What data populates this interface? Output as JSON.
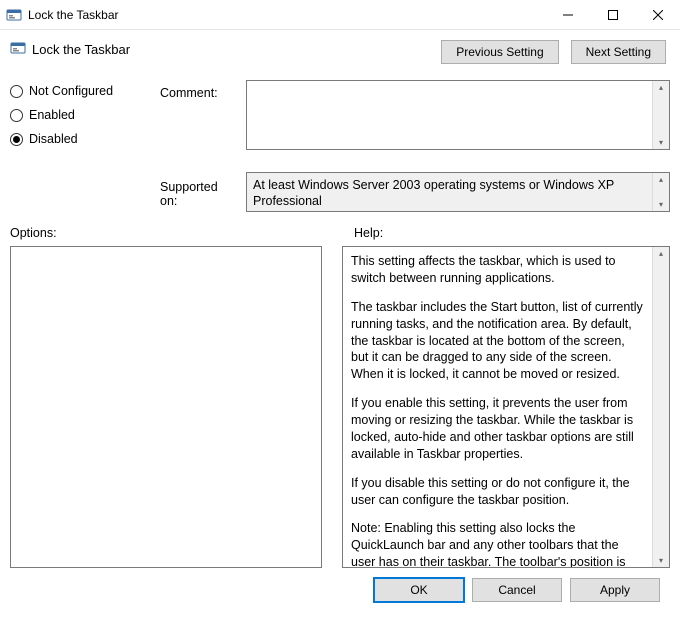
{
  "window": {
    "title": "Lock the Taskbar"
  },
  "header": {
    "policy_name": "Lock the Taskbar",
    "prev_btn": "Previous Setting",
    "next_btn": "Next Setting"
  },
  "radios": {
    "not_configured": "Not Configured",
    "enabled": "Enabled",
    "disabled": "Disabled",
    "selected": "disabled"
  },
  "fields": {
    "comment_label": "Comment:",
    "comment_value": "",
    "supported_label": "Supported on:",
    "supported_value": "At least Windows Server 2003 operating systems or Windows XP Professional"
  },
  "panels": {
    "options_label": "Options:",
    "help_label": "Help:",
    "help_paragraphs": [
      "This setting affects the taskbar, which is used to switch between running applications.",
      "The taskbar includes the Start button, list of currently running tasks, and the notification area. By default, the taskbar is located at the bottom of the screen, but it can be dragged to any side of the screen. When it is locked, it cannot be moved or resized.",
      "If you enable this setting, it prevents the user from moving or resizing the taskbar. While the taskbar is locked, auto-hide and other taskbar options are still available in Taskbar properties.",
      "If you disable this setting or do not configure it, the user can configure the taskbar position.",
      "Note: Enabling this setting also locks the QuickLaunch bar and any other toolbars that the user has on their taskbar. The toolbar's position is locked, and the user cannot show and hide various toolbars using the taskbar context menu."
    ]
  },
  "footer": {
    "ok": "OK",
    "cancel": "Cancel",
    "apply": "Apply"
  }
}
